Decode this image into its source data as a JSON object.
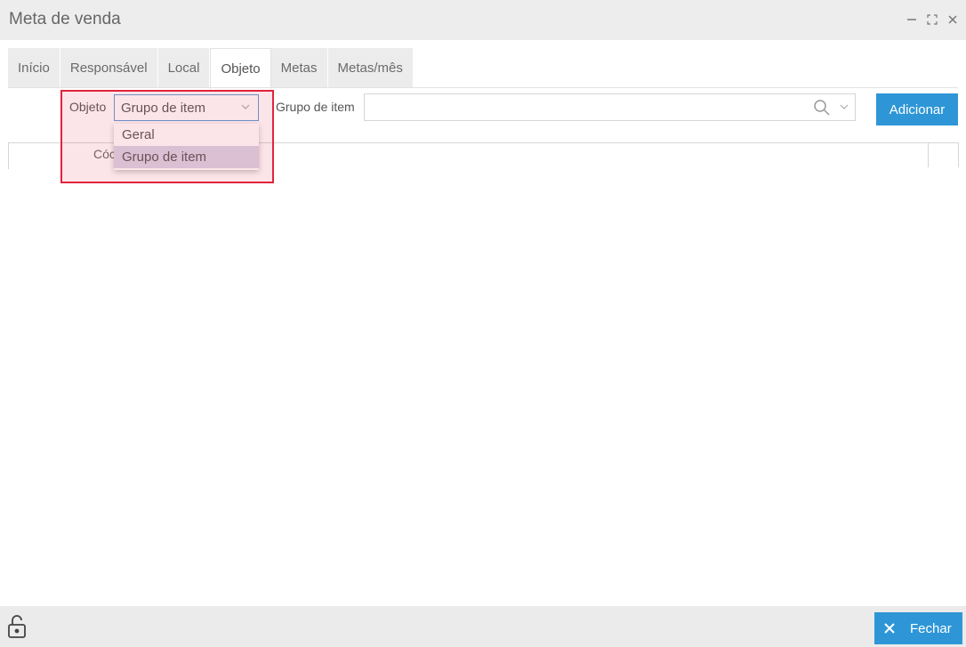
{
  "window": {
    "title": "Meta de venda",
    "controls": {
      "minimize_icon": "minimize-icon",
      "maximize_icon": "maximize-icon",
      "close_icon": "close-icon"
    }
  },
  "tabs": [
    {
      "label": "Início",
      "active": false
    },
    {
      "label": "Responsável",
      "active": false
    },
    {
      "label": "Local",
      "active": false
    },
    {
      "label": "Objeto",
      "active": true
    },
    {
      "label": "Metas",
      "active": false
    },
    {
      "label": "Metas/mês",
      "active": false
    }
  ],
  "objeto_field": {
    "label": "Objeto",
    "value": "Grupo de item",
    "options": [
      "Geral",
      "Grupo de item"
    ],
    "highlighted_option": "Grupo de item"
  },
  "grupo_field": {
    "label": "Grupo de item",
    "value": "",
    "icons": [
      "search-icon",
      "chevron-down-icon"
    ]
  },
  "actions": {
    "add_label": "Adicionar",
    "close_label": "Fechar"
  },
  "grid": {
    "partial_column_label": "Cóc"
  },
  "footer": {
    "lock_icon": "unlock-icon"
  },
  "colors": {
    "accent": "#2e96d6",
    "highlight_border": "#e0243c",
    "titlebar_bg": "#ededed"
  }
}
